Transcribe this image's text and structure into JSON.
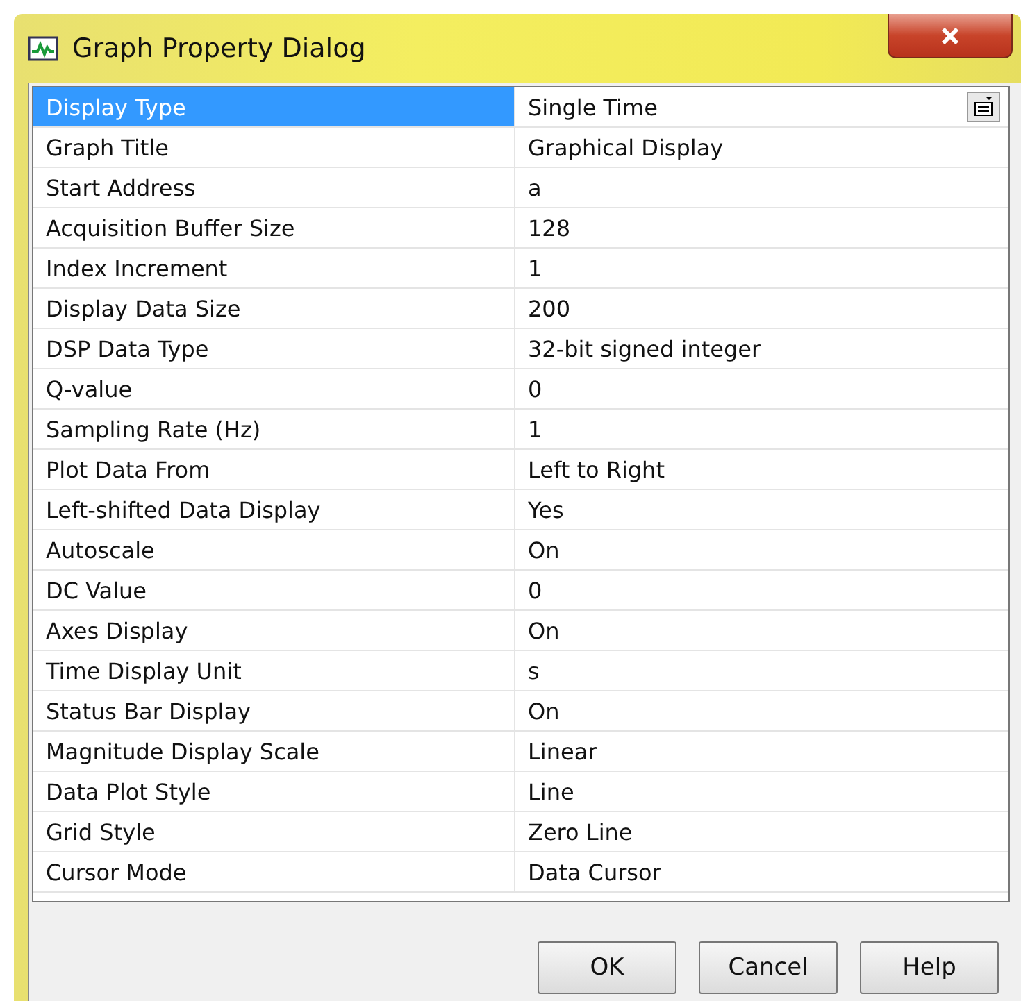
{
  "window": {
    "title": "Graph Property Dialog"
  },
  "properties": [
    {
      "name": "Display Type",
      "value": "Single Time",
      "selected": true,
      "kind": "dropdown"
    },
    {
      "name": "Graph Title",
      "value": "Graphical Display",
      "selected": false,
      "kind": "text"
    },
    {
      "name": "Start Address",
      "value": "a",
      "selected": false,
      "kind": "text"
    },
    {
      "name": "Acquisition Buffer Size",
      "value": "128",
      "selected": false,
      "kind": "text"
    },
    {
      "name": "Index Increment",
      "value": "1",
      "selected": false,
      "kind": "text"
    },
    {
      "name": "Display Data Size",
      "value": "200",
      "selected": false,
      "kind": "text"
    },
    {
      "name": "DSP Data Type",
      "value": "32-bit signed integer",
      "selected": false,
      "kind": "text"
    },
    {
      "name": "Q-value",
      "value": "0",
      "selected": false,
      "kind": "text"
    },
    {
      "name": "Sampling Rate (Hz)",
      "value": "1",
      "selected": false,
      "kind": "text"
    },
    {
      "name": "Plot Data From",
      "value": "Left to Right",
      "selected": false,
      "kind": "text"
    },
    {
      "name": "Left-shifted Data Display",
      "value": "Yes",
      "selected": false,
      "kind": "text"
    },
    {
      "name": "Autoscale",
      "value": "On",
      "selected": false,
      "kind": "text"
    },
    {
      "name": "DC Value",
      "value": "0",
      "selected": false,
      "kind": "text"
    },
    {
      "name": "Axes Display",
      "value": "On",
      "selected": false,
      "kind": "text"
    },
    {
      "name": "Time Display Unit",
      "value": "s",
      "selected": false,
      "kind": "text"
    },
    {
      "name": "Status Bar Display",
      "value": "On",
      "selected": false,
      "kind": "text"
    },
    {
      "name": "Magnitude Display Scale",
      "value": "Linear",
      "selected": false,
      "kind": "text"
    },
    {
      "name": "Data Plot Style",
      "value": "Line",
      "selected": false,
      "kind": "text"
    },
    {
      "name": "Grid Style",
      "value": "Zero Line",
      "selected": false,
      "kind": "text"
    },
    {
      "name": "Cursor Mode",
      "value": "Data Cursor",
      "selected": false,
      "kind": "text"
    }
  ],
  "buttons": [
    "OK",
    "Cancel",
    "Help"
  ]
}
